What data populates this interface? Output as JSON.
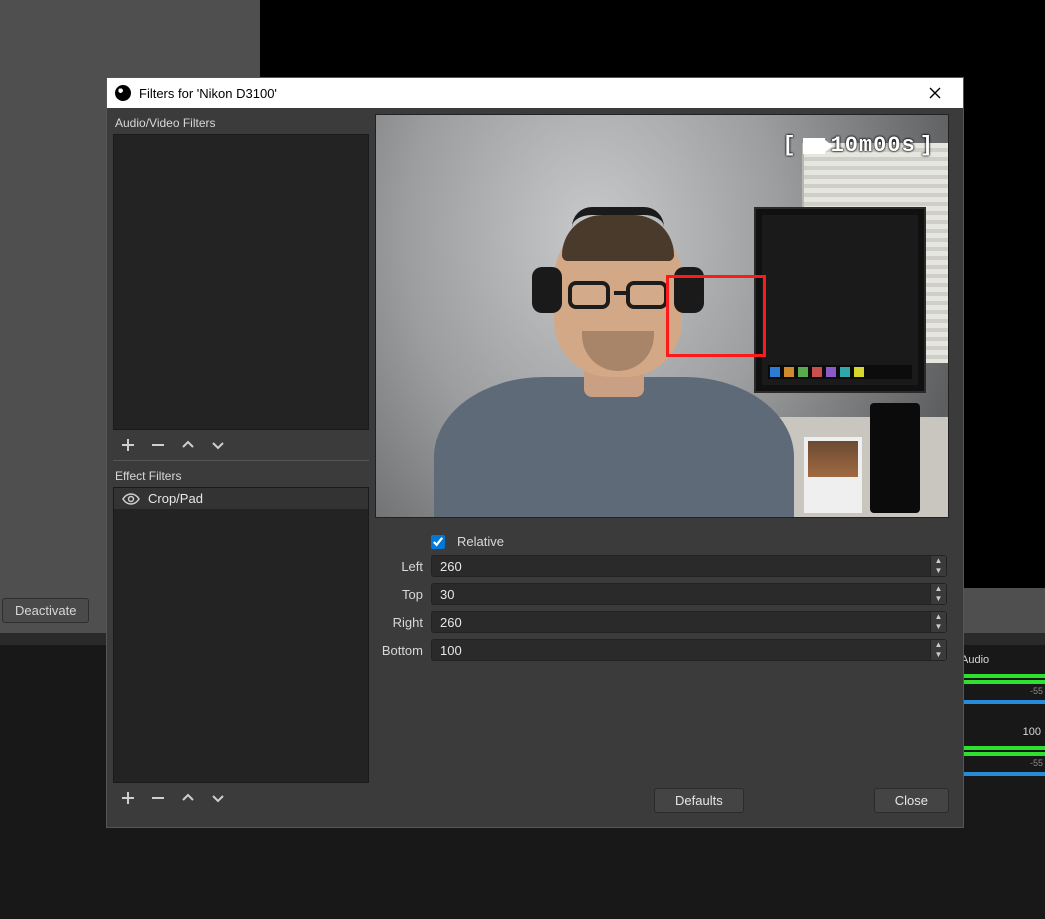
{
  "background": {
    "deactivate_label": "Deactivate",
    "mixer": {
      "track1_label": "Audio",
      "track2_num": "100"
    }
  },
  "dialog": {
    "title": "Filters for 'Nikon D3100'",
    "sections": {
      "av_label": "Audio/Video Filters",
      "effect_label": "Effect Filters"
    },
    "effect_filters": [
      {
        "name": "Crop/Pad"
      }
    ],
    "preview": {
      "timer_text": "10m00s"
    },
    "props": {
      "relative_label": "Relative",
      "relative_checked": true,
      "left": {
        "label": "Left",
        "value": "260"
      },
      "top": {
        "label": "Top",
        "value": "30"
      },
      "right": {
        "label": "Right",
        "value": "260"
      },
      "bottom": {
        "label": "Bottom",
        "value": "100"
      }
    },
    "buttons": {
      "defaults": "Defaults",
      "close": "Close"
    }
  }
}
